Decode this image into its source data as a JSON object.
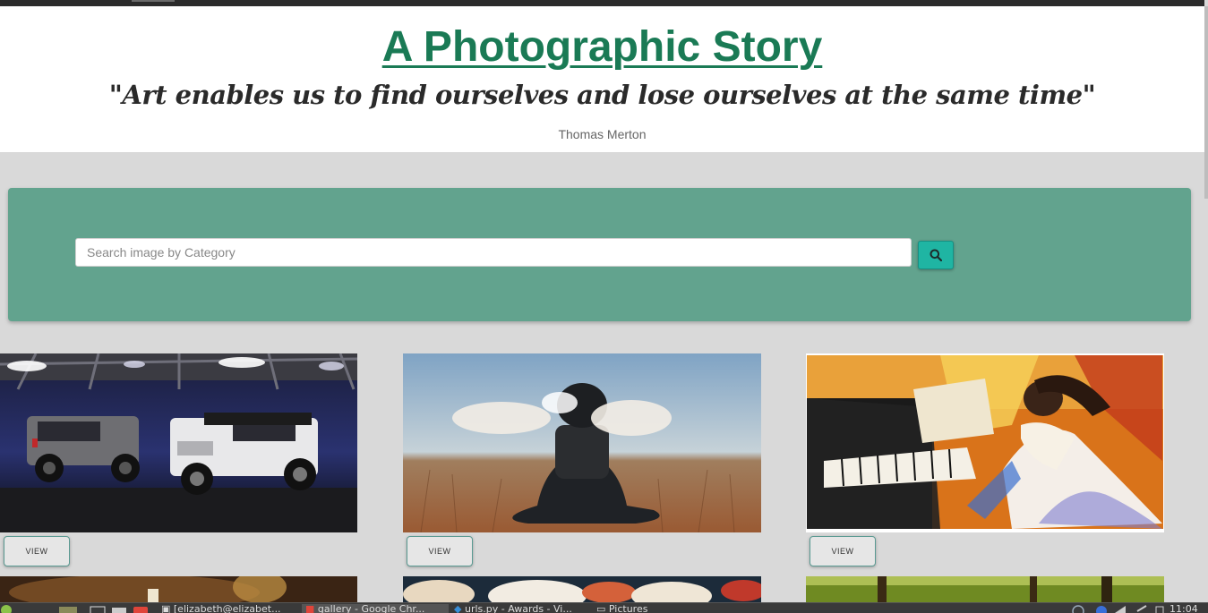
{
  "header": {
    "title": "A Photographic Story",
    "quote": "\"Art enables us to find ourselves and lose ourselves at the same time\"",
    "author": "Thomas Merton"
  },
  "search": {
    "placeholder": "Search image by Category",
    "button_icon": "search-icon"
  },
  "gallery": {
    "cards": [
      {
        "image": "jeep-wranglers-photo",
        "button_label": "VIEW"
      },
      {
        "image": "person-in-field-photo",
        "button_label": "VIEW"
      },
      {
        "image": "woman-playing-piano-painting",
        "button_label": "VIEW"
      }
    ],
    "next_row": [
      "coffee-photo",
      "food-table-photo",
      "green-trees-photo"
    ]
  },
  "taskbar": {
    "items": [
      "[elizabeth@elizabet...",
      "gallery - Google Chr...",
      "urls.py - Awards - Vi...",
      "Pictures"
    ],
    "clock": "11:04"
  },
  "colors": {
    "title": "#1a7a55",
    "search_panel": "#62a38e",
    "search_button": "#1fb5a3",
    "page_bg": "#d9d9d9"
  }
}
